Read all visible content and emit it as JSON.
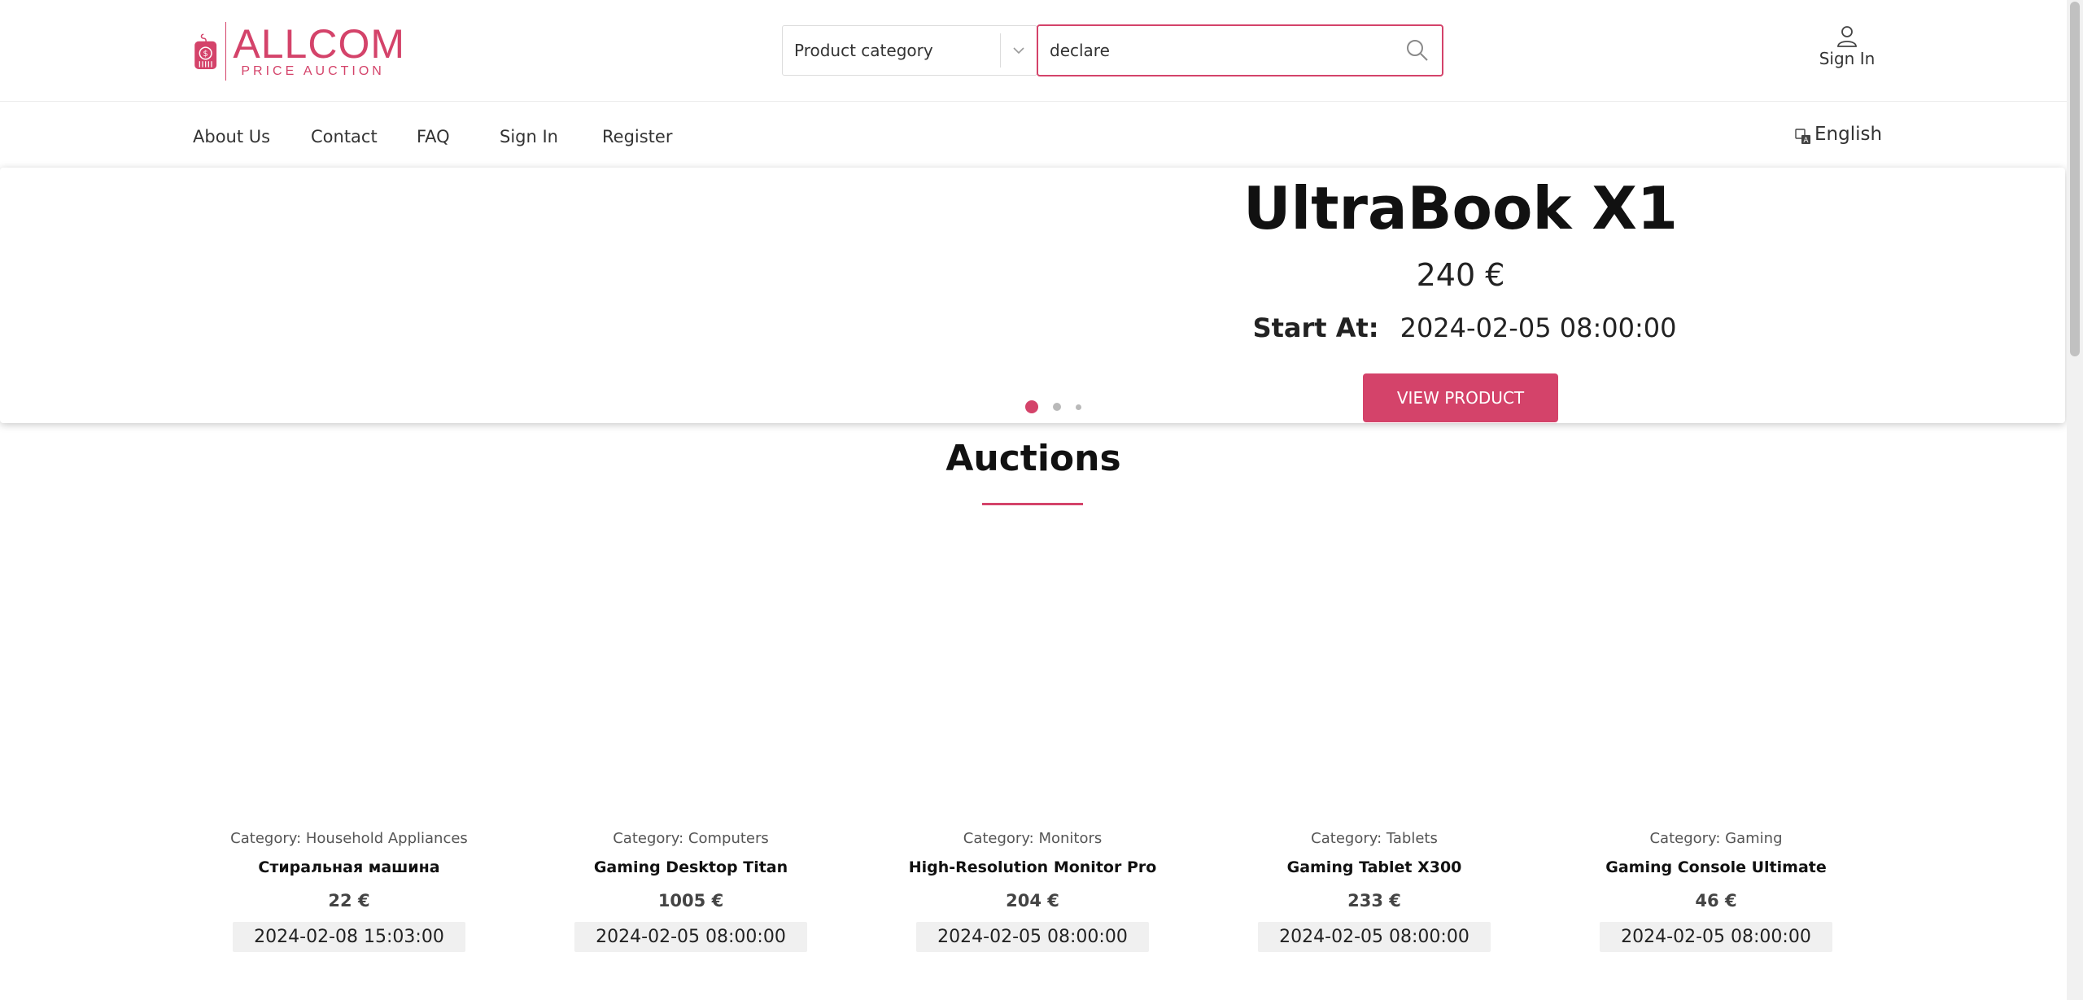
{
  "brand": {
    "name": "ALLCOM",
    "tagline": "PRICE AUCTION",
    "accent": "#d4436a"
  },
  "header": {
    "category_label": "Product category",
    "search_value": "declare",
    "signin_label": "Sign In"
  },
  "nav": {
    "items": [
      {
        "label": "About Us"
      },
      {
        "label": "Contact"
      },
      {
        "label": "FAQ"
      },
      {
        "label": "Sign In"
      },
      {
        "label": "Register"
      }
    ],
    "language": "English"
  },
  "hero": {
    "title": "UltraBook X1",
    "price": "240 €",
    "start_label": "Start At:",
    "start_value": "2024-02-05 08:00:00",
    "button": "VIEW PRODUCT",
    "slides": 3,
    "active_slide": 1
  },
  "auctions": {
    "title": "Auctions",
    "items": [
      {
        "category": "Category: Household Appliances",
        "name": "Стиральная машина",
        "price": "22 €",
        "date": "2024-02-08 15:03:00"
      },
      {
        "category": "Category: Computers",
        "name": "Gaming Desktop Titan",
        "price": "1005 €",
        "date": "2024-02-05 08:00:00"
      },
      {
        "category": "Category: Monitors",
        "name": "High-Resolution Monitor Pro",
        "price": "204 €",
        "date": "2024-02-05 08:00:00"
      },
      {
        "category": "Category: Tablets",
        "name": "Gaming Tablet X300",
        "price": "233 €",
        "date": "2024-02-05 08:00:00"
      },
      {
        "category": "Category: Gaming",
        "name": "Gaming Console Ultimate",
        "price": "46 €",
        "date": "2024-02-05 08:00:00"
      }
    ]
  },
  "icons": {
    "logo": "price-tag-dollar-icon",
    "dropdown": "chevron-down-icon",
    "search": "search-icon",
    "user": "user-icon",
    "language": "translate-icon"
  }
}
